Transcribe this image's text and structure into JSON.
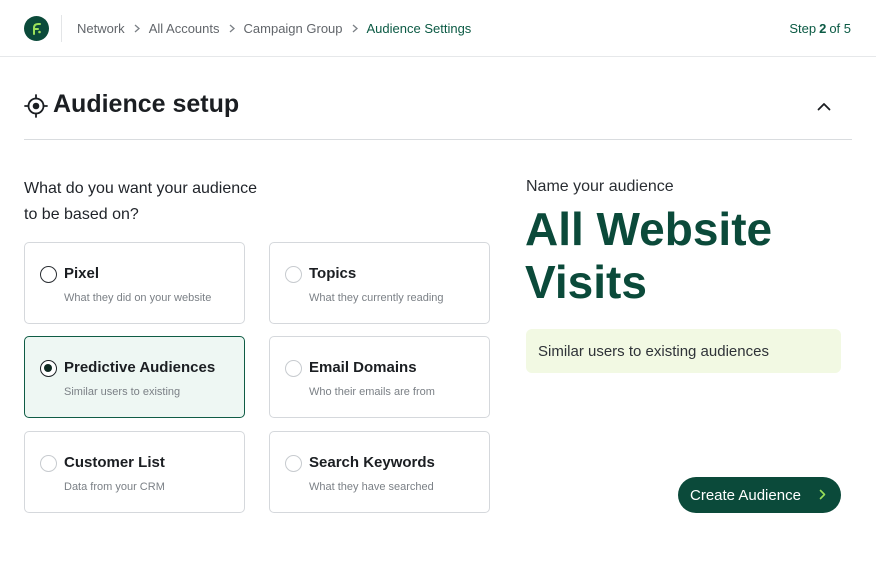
{
  "header": {
    "breadcrumbs": [
      "Network",
      "All Accounts",
      "Campaign Group",
      "Audience Settings"
    ],
    "step": {
      "prefix": "Step",
      "current": "2",
      "of_text": "of 5"
    }
  },
  "section": {
    "title": "Audience setup",
    "icon": "target-icon"
  },
  "question": {
    "line1": "What do you want your audience",
    "line2": "to be based on?"
  },
  "options": [
    {
      "title": "Pixel",
      "subtitle": "What they did on your website",
      "selected": false
    },
    {
      "title": "Topics",
      "subtitle": "What they currently reading",
      "selected": false
    },
    {
      "title": "Predictive Audiences",
      "subtitle": "Similar users to existing",
      "selected": true
    },
    {
      "title": "Email Domains",
      "subtitle": "Who their emails are from",
      "selected": false
    },
    {
      "title": "Customer List",
      "subtitle": "Data from your CRM",
      "selected": false
    },
    {
      "title": "Search Keywords",
      "subtitle": "What they have searched",
      "selected": false
    }
  ],
  "audience_name": {
    "label": "Name your audience",
    "value_line1": "All Website",
    "value_line2": "Visits"
  },
  "description": "Similar users to existing audiences",
  "cta": {
    "label": "Create Audience"
  },
  "colors": {
    "brand": "#0b4a3a",
    "selected_bg": "#eef7f3",
    "desc_bg": "#f2f9e3"
  }
}
